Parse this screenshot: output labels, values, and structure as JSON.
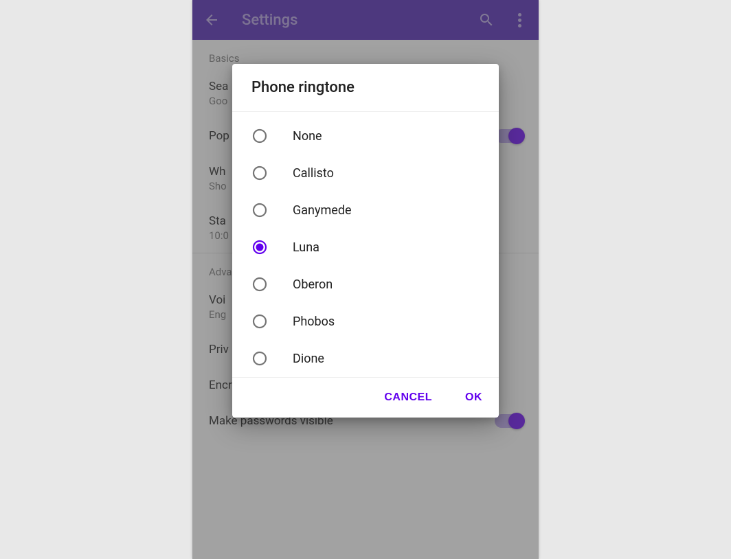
{
  "appbar": {
    "title": "Settings"
  },
  "sections": {
    "basics": {
      "header": "Basics",
      "items": [
        {
          "title": "Sea",
          "sub": "Goo"
        },
        {
          "title": "Pop",
          "switch": true
        },
        {
          "title": "Wh",
          "sub": "Sho"
        },
        {
          "title": "Sta",
          "sub": "10:0"
        }
      ]
    },
    "advanced": {
      "header": "Adva",
      "items": [
        {
          "title": "Voi",
          "sub": "Eng"
        },
        {
          "title": "Priv"
        },
        {
          "title": "Encryption"
        },
        {
          "title": "Make passwords visible",
          "switch": true
        }
      ]
    }
  },
  "dialog": {
    "title": "Phone ringtone",
    "options": [
      {
        "label": "None",
        "selected": false
      },
      {
        "label": "Callisto",
        "selected": false
      },
      {
        "label": "Ganymede",
        "selected": false
      },
      {
        "label": "Luna",
        "selected": true
      },
      {
        "label": "Oberon",
        "selected": false
      },
      {
        "label": "Phobos",
        "selected": false
      },
      {
        "label": "Dione",
        "selected": false
      }
    ],
    "cancel_label": "CANCEL",
    "ok_label": "OK"
  }
}
